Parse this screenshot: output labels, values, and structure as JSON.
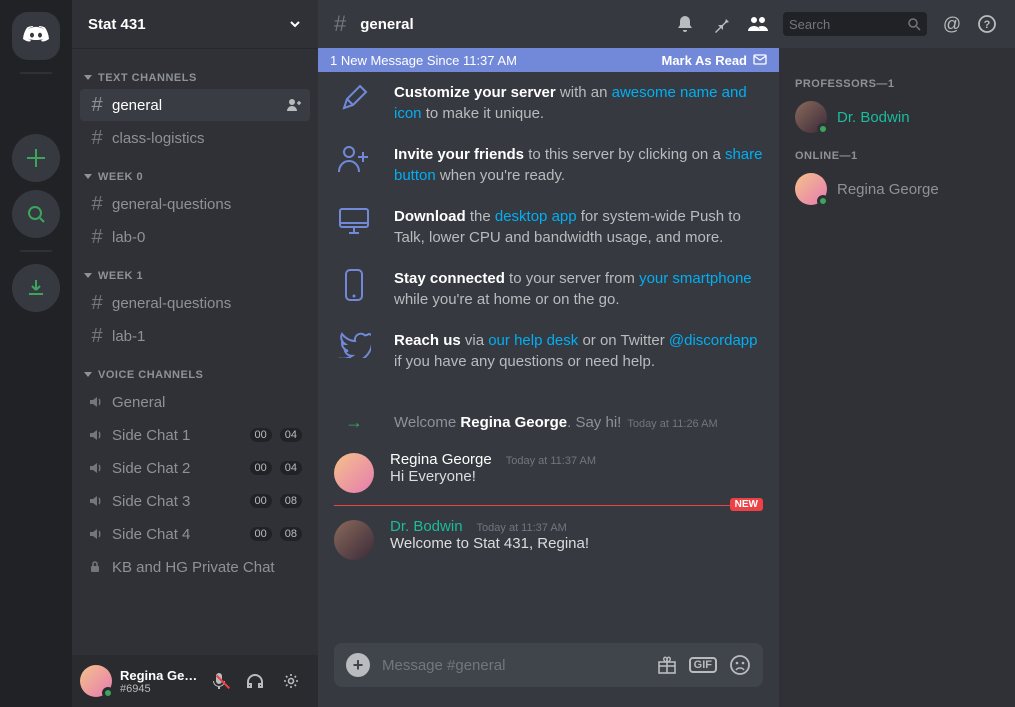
{
  "server": {
    "name": "Stat 431"
  },
  "categories": [
    {
      "label": "TEXT CHANNELS",
      "channels": [
        {
          "name": "general",
          "type": "text",
          "active": true,
          "addUser": true
        },
        {
          "name": "class-logistics",
          "type": "text"
        }
      ]
    },
    {
      "label": "WEEK 0",
      "channels": [
        {
          "name": "general-questions",
          "type": "text"
        },
        {
          "name": "lab-0",
          "type": "text"
        }
      ]
    },
    {
      "label": "WEEK 1",
      "channels": [
        {
          "name": "general-questions",
          "type": "text"
        },
        {
          "name": "lab-1",
          "type": "text"
        }
      ]
    },
    {
      "label": "VOICE CHANNELS",
      "channels": [
        {
          "name": "General",
          "type": "voice"
        },
        {
          "name": "Side Chat 1",
          "type": "voice",
          "badges": [
            "00",
            "04"
          ]
        },
        {
          "name": "Side Chat 2",
          "type": "voice",
          "badges": [
            "00",
            "04"
          ]
        },
        {
          "name": "Side Chat 3",
          "type": "voice",
          "badges": [
            "00",
            "08"
          ]
        },
        {
          "name": "Side Chat 4",
          "type": "voice",
          "badges": [
            "00",
            "08"
          ]
        },
        {
          "name": "KB and HG Private Chat",
          "type": "locked"
        }
      ]
    }
  ],
  "userPanel": {
    "name": "Regina Geor...",
    "tag": "#6945"
  },
  "chatHeader": {
    "channel": "general"
  },
  "newBar": {
    "text": "1 New Message Since 11:37 AM",
    "action": "Mark As Read"
  },
  "welcome": [
    {
      "icon": "pencil",
      "bold": "Customize your server",
      "mid": " with an ",
      "link": "awesome name and icon",
      "tail": " to make it unique."
    },
    {
      "icon": "invite",
      "bold": "Invite your friends",
      "mid": " to this server by clicking on a ",
      "link": "share button",
      "tail": " when you're ready."
    },
    {
      "icon": "desktop",
      "bold": "Download",
      "mid": " the ",
      "link": "desktop app",
      "tail": " for system-wide Push to Talk, lower CPU and bandwidth usage, and more."
    },
    {
      "icon": "phone",
      "bold": "Stay connected",
      "mid": " to your server from ",
      "link": "your smartphone",
      "tail": " while you're at home or on the go."
    },
    {
      "icon": "twitter",
      "bold": "Reach us",
      "mid": " via ",
      "link": "our help desk",
      "mid2": " or on Twitter ",
      "link2": "@discordapp",
      "tail": " if you have any questions or need help."
    }
  ],
  "joinMsg": {
    "pre": "Welcome ",
    "name": "Regina George",
    "post": ". Say hi!",
    "time": "Today at 11:26 AM"
  },
  "messages": [
    {
      "author": "Regina George",
      "role": "user",
      "time": "Today at 11:37 AM",
      "text": "Hi Everyone!"
    },
    {
      "author": "Dr. Bodwin",
      "role": "prof",
      "time": "Today at 11:37 AM",
      "text": "Welcome to Stat 431, Regina!"
    }
  ],
  "newPill": "NEW",
  "input": {
    "placeholder": "Message #general",
    "gif": "GIF"
  },
  "search": {
    "placeholder": "Search"
  },
  "members": {
    "groups": [
      {
        "label": "PROFESSORS—1",
        "people": [
          {
            "name": "Dr. Bodwin",
            "role": "prof",
            "avatar": "bodwin"
          }
        ]
      },
      {
        "label": "ONLINE—1",
        "people": [
          {
            "name": "Regina George",
            "role": "online",
            "avatar": "regina"
          }
        ]
      }
    ]
  }
}
